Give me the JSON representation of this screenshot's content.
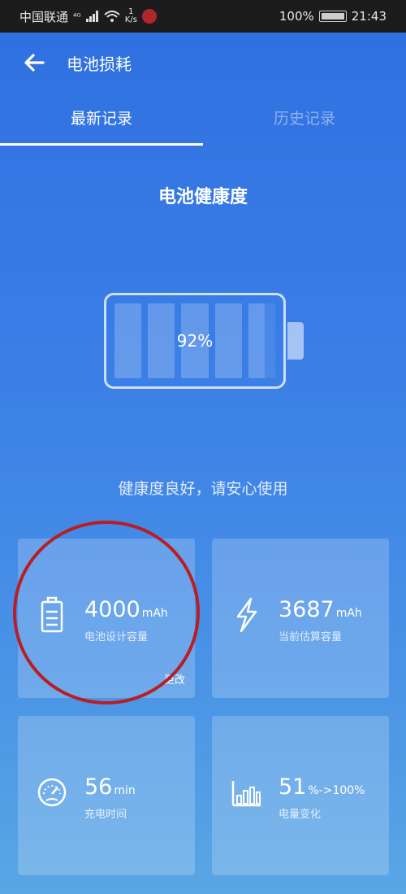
{
  "statusbar": {
    "carrier": "中国联通",
    "network": "⁴ᴳ",
    "speed_top": "1",
    "speed_unit": "K/s",
    "battery": "100%",
    "time": "21:43"
  },
  "appbar": {
    "title": "电池损耗",
    "back_icon": "arrow-left-icon"
  },
  "tabs": [
    {
      "label": "最新记录",
      "active": true
    },
    {
      "label": "历史记录",
      "active": false
    }
  ],
  "health": {
    "title": "电池健康度",
    "percent": "92%",
    "percent_value": 92,
    "status_text": "健康度良好，请安心使用"
  },
  "cards": [
    {
      "icon": "battery-document-icon",
      "value": "4000",
      "unit": "mAh",
      "label": "电池设计容量",
      "action": "更改"
    },
    {
      "icon": "lightning-icon",
      "value": "3687",
      "unit": "mAh",
      "label": "当前估算容量"
    },
    {
      "icon": "speedometer-icon",
      "value": "56",
      "unit": "min",
      "label": "充电时间"
    },
    {
      "icon": "bar-chart-icon",
      "value": "51",
      "unit": "%->100%",
      "label": "电量变化"
    }
  ],
  "colors": {
    "accent_ring": "#b81e24",
    "background_top": "#2f6fe0",
    "background_bottom": "#5aa6e4"
  }
}
